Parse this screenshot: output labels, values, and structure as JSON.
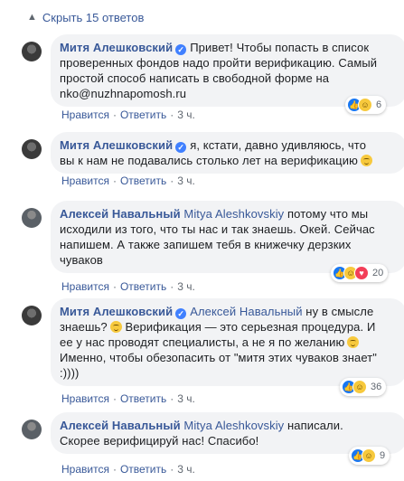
{
  "hide_replies": {
    "label": "Скрыть 15 ответов"
  },
  "comments": [
    {
      "author": "Митя Алешковский",
      "verified": true,
      "mention": "",
      "lines": [
        "Привет! Чтобы попасть в список",
        "проверенных фондов надо пройти верификацию. Самый",
        "простой способ написать в свободной форме на",
        "nko@nuzhnapomosh.ru"
      ],
      "emoji_after_last": false,
      "actions": {
        "like": "Нравится",
        "reply": "Ответить",
        "time": "3 ч."
      },
      "reactions": {
        "icons": [
          "like-icon",
          "haha-icon"
        ],
        "count": "6"
      }
    },
    {
      "author": "Митя Алешковский",
      "verified": true,
      "mention": "",
      "lines": [
        "я, кстати, давно удивляюсь, что",
        "вы к нам не подавались столько лет на верификацию"
      ],
      "emoji_after_last": true,
      "actions": {
        "like": "Нравится",
        "reply": "Ответить",
        "time": "3 ч."
      },
      "reactions": {
        "icons": [],
        "count": ""
      }
    },
    {
      "author": "Алексей Навальный",
      "verified": false,
      "mention": "Mitya Aleshkovskiy",
      "lines": [
        "потому что мы",
        "исходили из того, что ты нас и так знаешь. Окей. Сейчас",
        "напишем. А также запишем тебя в книжечку дерзких",
        "чуваков"
      ],
      "emoji_after_last": false,
      "actions": {
        "like": "Нравится",
        "reply": "Ответить",
        "time": "3 ч."
      },
      "reactions": {
        "icons": [
          "like-icon",
          "haha-icon",
          "love-icon"
        ],
        "count": "20"
      }
    },
    {
      "author": "Митя Алешковский",
      "verified": true,
      "mention": "Алексей Навальный",
      "lines": [
        "ну в смысле",
        "знаешь?",
        "Верификация — это серьезная процедура. И",
        "ее у нас проводят специалисты, а не я по желанию",
        "Именно, чтобы обезопасить от \"митя этих чуваков знает\"",
        ":))))"
      ],
      "emoji_after_last": false,
      "actions": {
        "like": "Нравится",
        "reply": "Ответить",
        "time": "3 ч."
      },
      "reactions": {
        "icons": [
          "like-icon",
          "haha-icon"
        ],
        "count": "36"
      }
    },
    {
      "author": "Алексей Навальный",
      "verified": false,
      "mention": "Mitya Aleshkovskiy",
      "lines": [
        "написали.",
        "Скорее верифицируй нас! Спасибо!"
      ],
      "emoji_after_last": false,
      "actions": {
        "like": "Нравится",
        "reply": "Ответить",
        "time": "3 ч."
      },
      "reactions": {
        "icons": [
          "like-icon",
          "haha-icon"
        ],
        "count": "9"
      }
    }
  ]
}
